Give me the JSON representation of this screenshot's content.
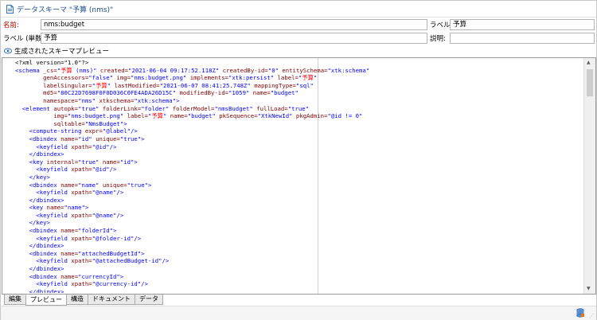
{
  "window": {
    "title": "データスキーマ \"予算 (nms)\""
  },
  "form": {
    "name_label": "名前:",
    "name_value": "nms:budget",
    "label_label": "ラベル:",
    "label_value": "予算",
    "singular_label": "ラベル (単数):",
    "singular_value": "予算",
    "description_label": "説明:",
    "description_value": ""
  },
  "preview": {
    "section_label": "生成されたスキーマプレビュー"
  },
  "code_lines": [
    [
      [
        "<?xml version=\"1.0\"?>",
        "bk"
      ]
    ],
    [
      [
        "<schema ",
        "b"
      ],
      [
        "_cs=",
        "m"
      ],
      [
        "\"",
        "b"
      ],
      [
        "予算",
        "r"
      ],
      [
        " (nms)\" ",
        "b"
      ],
      [
        "created=",
        "m"
      ],
      [
        "\"2021-06-04 09:17:52.118Z\" ",
        "b"
      ],
      [
        "createdBy-id=",
        "m"
      ],
      [
        "\"0\" ",
        "b"
      ],
      [
        "entitySchema=",
        "m"
      ],
      [
        "\"xtk:schema\"",
        "b"
      ]
    ],
    [
      [
        "        genAccessors=",
        "m"
      ],
      [
        "\"false\" ",
        "b"
      ],
      [
        "img=",
        "m"
      ],
      [
        "\"nms:budget.png\" ",
        "b"
      ],
      [
        "implements=",
        "m"
      ],
      [
        "\"xtk:persist\" ",
        "b"
      ],
      [
        "label=",
        "m"
      ],
      [
        "\"",
        "b"
      ],
      [
        "予算",
        "r"
      ],
      [
        "\"",
        "b"
      ]
    ],
    [
      [
        "        labelSingular=",
        "m"
      ],
      [
        "\"",
        "b"
      ],
      [
        "予算",
        "r"
      ],
      [
        "\" ",
        "b"
      ],
      [
        "lastModified=",
        "m"
      ],
      [
        "\"2021-06-07 08:41:25.748Z\" ",
        "b"
      ],
      [
        "mappingType=",
        "m"
      ],
      [
        "\"sql\"",
        "b"
      ]
    ],
    [
      [
        "        md5=",
        "m"
      ],
      [
        "\"80C22D7698F0F0D036C0FE4ADA26D15C\" ",
        "b"
      ],
      [
        "modifiedBy-id=",
        "m"
      ],
      [
        "\"1059\" ",
        "b"
      ],
      [
        "name=",
        "m"
      ],
      [
        "\"budget\"",
        "b"
      ]
    ],
    [
      [
        "        namespace=",
        "m"
      ],
      [
        "\"nms\" ",
        "b"
      ],
      [
        "xtkschema=",
        "m"
      ],
      [
        "\"xtk:schema\">",
        "b"
      ]
    ],
    [
      [
        "  <element ",
        "b"
      ],
      [
        "autopk=",
        "m"
      ],
      [
        "\"true\" ",
        "b"
      ],
      [
        "folderLink=",
        "m"
      ],
      [
        "\"folder\" ",
        "b"
      ],
      [
        "folderModel=",
        "m"
      ],
      [
        "\"nmsBudget\" ",
        "b"
      ],
      [
        "fullLoad=",
        "m"
      ],
      [
        "\"true\"",
        "b"
      ]
    ],
    [
      [
        "           img=",
        "m"
      ],
      [
        "\"nms:budget.png\" ",
        "b"
      ],
      [
        "label=",
        "m"
      ],
      [
        "\"",
        "b"
      ],
      [
        "予算",
        "r"
      ],
      [
        "\" ",
        "b"
      ],
      [
        "name=",
        "m"
      ],
      [
        "\"budget\" ",
        "b"
      ],
      [
        "pkSequence=",
        "m"
      ],
      [
        "\"XtkNewId\" ",
        "b"
      ],
      [
        "pkgAdmin=",
        "m"
      ],
      [
        "\"@id != 0\"",
        "b"
      ]
    ],
    [
      [
        "           sqltable=",
        "m"
      ],
      [
        "\"NmsBudget\">",
        "b"
      ]
    ],
    [
      [
        "    <compute-string ",
        "b"
      ],
      [
        "expr=",
        "m"
      ],
      [
        "\"@label\"",
        "b"
      ],
      [
        "/>",
        "b"
      ]
    ],
    [
      [
        "    <dbindex ",
        "b"
      ],
      [
        "name=",
        "m"
      ],
      [
        "\"id\" ",
        "b"
      ],
      [
        "unique=",
        "m"
      ],
      [
        "\"true\">",
        "b"
      ]
    ],
    [
      [
        "      <keyfield ",
        "b"
      ],
      [
        "xpath=",
        "m"
      ],
      [
        "\"@id\"",
        "b"
      ],
      [
        "/>",
        "b"
      ]
    ],
    [
      [
        "    </dbindex>",
        "b"
      ]
    ],
    [
      [
        "    <key ",
        "b"
      ],
      [
        "internal=",
        "m"
      ],
      [
        "\"true\" ",
        "b"
      ],
      [
        "name=",
        "m"
      ],
      [
        "\"id\">",
        "b"
      ]
    ],
    [
      [
        "      <keyfield ",
        "b"
      ],
      [
        "xpath=",
        "m"
      ],
      [
        "\"@id\"",
        "b"
      ],
      [
        "/>",
        "b"
      ]
    ],
    [
      [
        "    </key>",
        "b"
      ]
    ],
    [
      [
        "    <dbindex ",
        "b"
      ],
      [
        "name=",
        "m"
      ],
      [
        "\"name\" ",
        "b"
      ],
      [
        "unique=",
        "m"
      ],
      [
        "\"true\">",
        "b"
      ]
    ],
    [
      [
        "      <keyfield ",
        "b"
      ],
      [
        "xpath=",
        "m"
      ],
      [
        "\"@name\"",
        "b"
      ],
      [
        "/>",
        "b"
      ]
    ],
    [
      [
        "    </dbindex>",
        "b"
      ]
    ],
    [
      [
        "    <key ",
        "b"
      ],
      [
        "name=",
        "m"
      ],
      [
        "\"name\">",
        "b"
      ]
    ],
    [
      [
        "      <keyfield ",
        "b"
      ],
      [
        "xpath=",
        "m"
      ],
      [
        "\"@name\"",
        "b"
      ],
      [
        "/>",
        "b"
      ]
    ],
    [
      [
        "    </key>",
        "b"
      ]
    ],
    [
      [
        "    <dbindex ",
        "b"
      ],
      [
        "name=",
        "m"
      ],
      [
        "\"folderId\">",
        "b"
      ]
    ],
    [
      [
        "      <keyfield ",
        "b"
      ],
      [
        "xpath=",
        "m"
      ],
      [
        "\"@folder-id\"",
        "b"
      ],
      [
        "/>",
        "b"
      ]
    ],
    [
      [
        "    </dbindex>",
        "b"
      ]
    ],
    [
      [
        "    <dbindex ",
        "b"
      ],
      [
        "name=",
        "m"
      ],
      [
        "\"attachedBudgetId\">",
        "b"
      ]
    ],
    [
      [
        "      <keyfield ",
        "b"
      ],
      [
        "xpath=",
        "m"
      ],
      [
        "\"@attachedBudget-id\"",
        "b"
      ],
      [
        "/>",
        "b"
      ]
    ],
    [
      [
        "    </dbindex>",
        "b"
      ]
    ],
    [
      [
        "    <dbindex ",
        "b"
      ],
      [
        "name=",
        "m"
      ],
      [
        "\"currencyId\">",
        "b"
      ]
    ],
    [
      [
        "      <keyfield ",
        "b"
      ],
      [
        "xpath=",
        "m"
      ],
      [
        "\"@currency-id\"",
        "b"
      ],
      [
        "/>",
        "b"
      ]
    ],
    [
      [
        "    </dbindex>",
        "b"
      ]
    ]
  ],
  "colors": {
    "tag": "#0000ff",
    "attribute": "#800000",
    "japanese_text": "#ff0000",
    "title_accent": "#1d4f91"
  },
  "tabs": [
    "編集",
    "プレビュー",
    "構造",
    "ドキュメント",
    "データ"
  ],
  "active_tab": "プレビュー"
}
